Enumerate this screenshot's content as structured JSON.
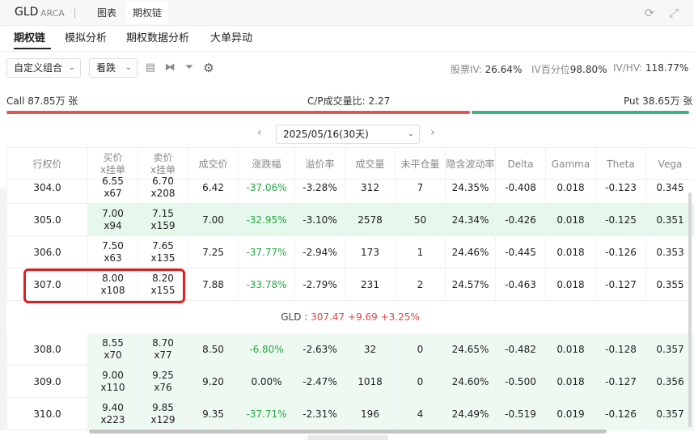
{
  "header": {
    "symbol": "GLD",
    "exchange": "ARCA",
    "tabs": [
      "图表",
      "期权链"
    ],
    "active_tab": "期权链",
    "icons": [
      "refresh-icon",
      "fullscreen-icon"
    ]
  },
  "subtabs": [
    "期权链",
    "模拟分析",
    "期权数据分析",
    "大单异动"
  ],
  "controls": {
    "combo_select": "自定义组合",
    "direction_select": "看跌",
    "icons": [
      "layout-icon",
      "split-icon",
      "filter-icon",
      "settings-icon"
    ],
    "stock_iv_label": "股票IV:",
    "stock_iv": "26.64%",
    "iv_pct_label": "IV百分位",
    "iv_pct": "98.80%",
    "iv_hv_label": "IV/HV:",
    "iv_hv": "118.77%"
  },
  "volume": {
    "call": "Call 87.85万 张",
    "ratio": "C/P成交量比: 2.27",
    "put": "Put 38.65万 张"
  },
  "expiry": {
    "value": "2025/05/16(30天)",
    "prev": "‹",
    "next": "›"
  },
  "table": {
    "headers": [
      "行权价",
      "买价\nx挂单",
      "卖价\nx挂单",
      "成交价",
      "涨跌幅",
      "溢价率",
      "成交量",
      "未平仓量",
      "隐含波动率",
      "Delta",
      "Gamma",
      "Theta",
      "Vega"
    ],
    "rows_top": [
      {
        "strike": "304.0",
        "bid": "6.55",
        "bid_size": "x67",
        "ask": "6.70",
        "ask_size": "x208",
        "last": "6.42",
        "chg": "-37.06%",
        "premium": "-3.28%",
        "vol": "312",
        "oi": "7",
        "iv": "24.35%",
        "delta": "-0.408",
        "gamma": "0.018",
        "theta": "-0.123",
        "vega": "0.345"
      },
      {
        "strike": "305.0",
        "bid": "7.00",
        "bid_size": "x94",
        "ask": "7.15",
        "ask_size": "x159",
        "last": "7.00",
        "chg": "-32.95%",
        "premium": "-3.10%",
        "vol": "2578",
        "oi": "50",
        "iv": "24.34%",
        "delta": "-0.426",
        "gamma": "0.018",
        "theta": "-0.125",
        "vega": "0.351"
      },
      {
        "strike": "306.0",
        "bid": "7.50",
        "bid_size": "x63",
        "ask": "7.65",
        "ask_size": "x135",
        "last": "7.25",
        "chg": "-37.77%",
        "premium": "-2.94%",
        "vol": "173",
        "oi": "1",
        "iv": "24.46%",
        "delta": "-0.445",
        "gamma": "0.018",
        "theta": "-0.126",
        "vega": "0.353"
      },
      {
        "strike": "307.0",
        "bid": "8.00",
        "bid_size": "x108",
        "ask": "8.20",
        "ask_size": "x155",
        "last": "7.88",
        "chg": "-33.78%",
        "premium": "-2.79%",
        "vol": "231",
        "oi": "2",
        "iv": "24.57%",
        "delta": "-0.463",
        "gamma": "0.018",
        "theta": "-0.127",
        "vega": "0.355"
      }
    ],
    "underlying": {
      "label": "GLD :",
      "price": "307.47",
      "change": "+9.69",
      "pct": "+3.25%"
    },
    "rows_bottom": [
      {
        "strike": "308.0",
        "bid": "8.55",
        "bid_size": "x70",
        "ask": "8.70",
        "ask_size": "x77",
        "last": "8.50",
        "chg": "-6.80%",
        "premium": "-2.63%",
        "vol": "32",
        "oi": "0",
        "iv": "24.65%",
        "delta": "-0.482",
        "gamma": "0.018",
        "theta": "-0.128",
        "vega": "0.357"
      },
      {
        "strike": "309.0",
        "bid": "9.00",
        "bid_size": "x110",
        "ask": "9.25",
        "ask_size": "x76",
        "last": "9.20",
        "chg": "0.00%",
        "premium": "-2.47%",
        "vol": "1018",
        "oi": "0",
        "iv": "24.60%",
        "delta": "-0.500",
        "gamma": "0.018",
        "theta": "-0.127",
        "vega": "0.356"
      },
      {
        "strike": "310.0",
        "bid": "9.40",
        "bid_size": "x223",
        "ask": "9.85",
        "ask_size": "x129",
        "last": "9.35",
        "chg": "-37.71%",
        "premium": "-2.31%",
        "vol": "196",
        "oi": "4",
        "iv": "24.49%",
        "delta": "-0.519",
        "gamma": "0.019",
        "theta": "-0.126",
        "vega": "0.357"
      }
    ]
  }
}
